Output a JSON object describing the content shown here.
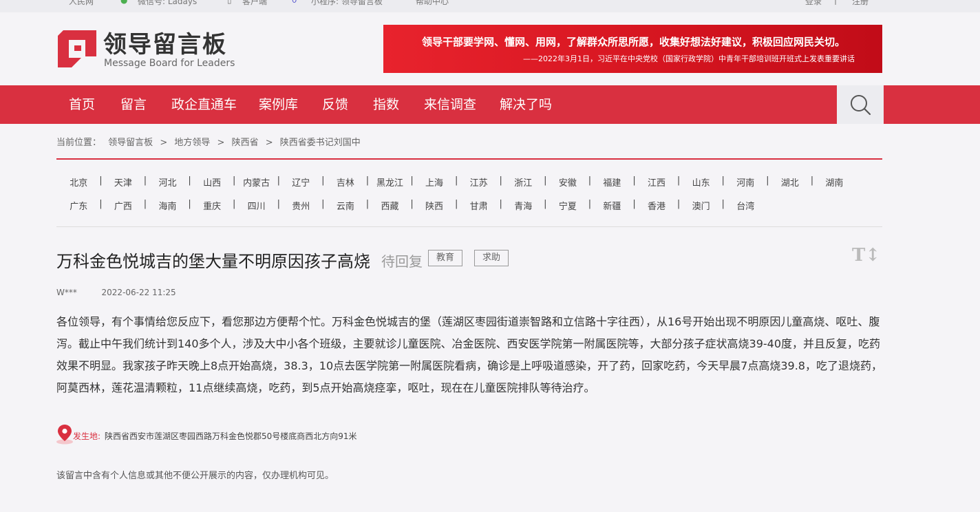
{
  "topbar": {
    "items": [
      "人民网",
      "微信号: Ladays",
      "客户端",
      "小程序: 领导留言板",
      "帮助中心"
    ],
    "login": "登录",
    "register": "注册"
  },
  "logo": {
    "cn": "领导留言板",
    "en": "Message Board for Leaders"
  },
  "banner": {
    "line1": "领导干部要学网、懂网、用网，了解群众所思所愿，收集好想法好建议，积极回应网民关切。",
    "line2": "——2022年3月1日，习近平在中央党校（国家行政学院）中青年干部培训班开班式上发表重要讲话"
  },
  "nav": {
    "items": [
      "首页",
      "留言",
      "政企直通车",
      "案例库",
      "反馈",
      "指数",
      "来信调查",
      "解决了吗"
    ],
    "search_icon": "search-icon"
  },
  "breadcrumb": {
    "label": "当前位置：",
    "items": [
      "领导留言板",
      ">",
      "地方领导",
      ">",
      "陕西省",
      ">",
      "陕西省委书记刘国中"
    ]
  },
  "provinces": {
    "row1": [
      "北京",
      "天津",
      "河北",
      "山西",
      "内蒙古",
      "辽宁",
      "吉林",
      "黑龙江",
      "上海",
      "江苏",
      "浙江",
      "安徽",
      "福建",
      "江西",
      "山东",
      "河南",
      "湖北",
      "湖南"
    ],
    "row2": [
      "广东",
      "广西",
      "海南",
      "重庆",
      "四川",
      "贵州",
      "云南",
      "西藏",
      "陕西",
      "甘肃",
      "青海",
      "宁夏",
      "新疆",
      "香港",
      "澳门",
      "台湾"
    ]
  },
  "post": {
    "title": "万科金色悦城吉的堡大量不明原因孩子高烧",
    "status": "待回复",
    "tags": [
      "教育",
      "求助"
    ],
    "font_toggle": "T↕",
    "author": "W***",
    "datetime": "2022-06-22 11:25",
    "content": "各位领导，有个事情给您反应下，看您那边方便帮个忙。万科金色悦城吉的堡（莲湖区枣园街道崇智路和立信路十字往西），从16号开始出现不明原因儿童高烧、呕吐、腹泻。截止中午我们统计到140多个人，涉及大中小各个班级，主要就诊儿童医院、冶金医院、西安医学院第一附属医院等，大部分孩子症状高烧39-40度，并且反复，吃药效果不明显。我家孩子昨天晚上8点开始高烧，38.3，10点去医学院第一附属医院看病，确诊是上呼吸道感染，开了药，回家吃药，今天早晨7点高烧39.8，吃了退烧药，阿莫西林，莲花温清颗粒，11点继续高烧，吃药，到5点开始高烧痉挛，呕吐，现在在儿童医院排队等待治疗。",
    "location_label": "发生地:",
    "location": "陕西省西安市莲湖区枣园西路万科金色悦郡50号楼底商西北方向91米",
    "privacy_note": "该留言中含有个人信息或其他不便公开展示的内容，仅办理机构可见。"
  },
  "colors": {
    "brand_red": "#d93040",
    "background": "#f5f4f7"
  }
}
